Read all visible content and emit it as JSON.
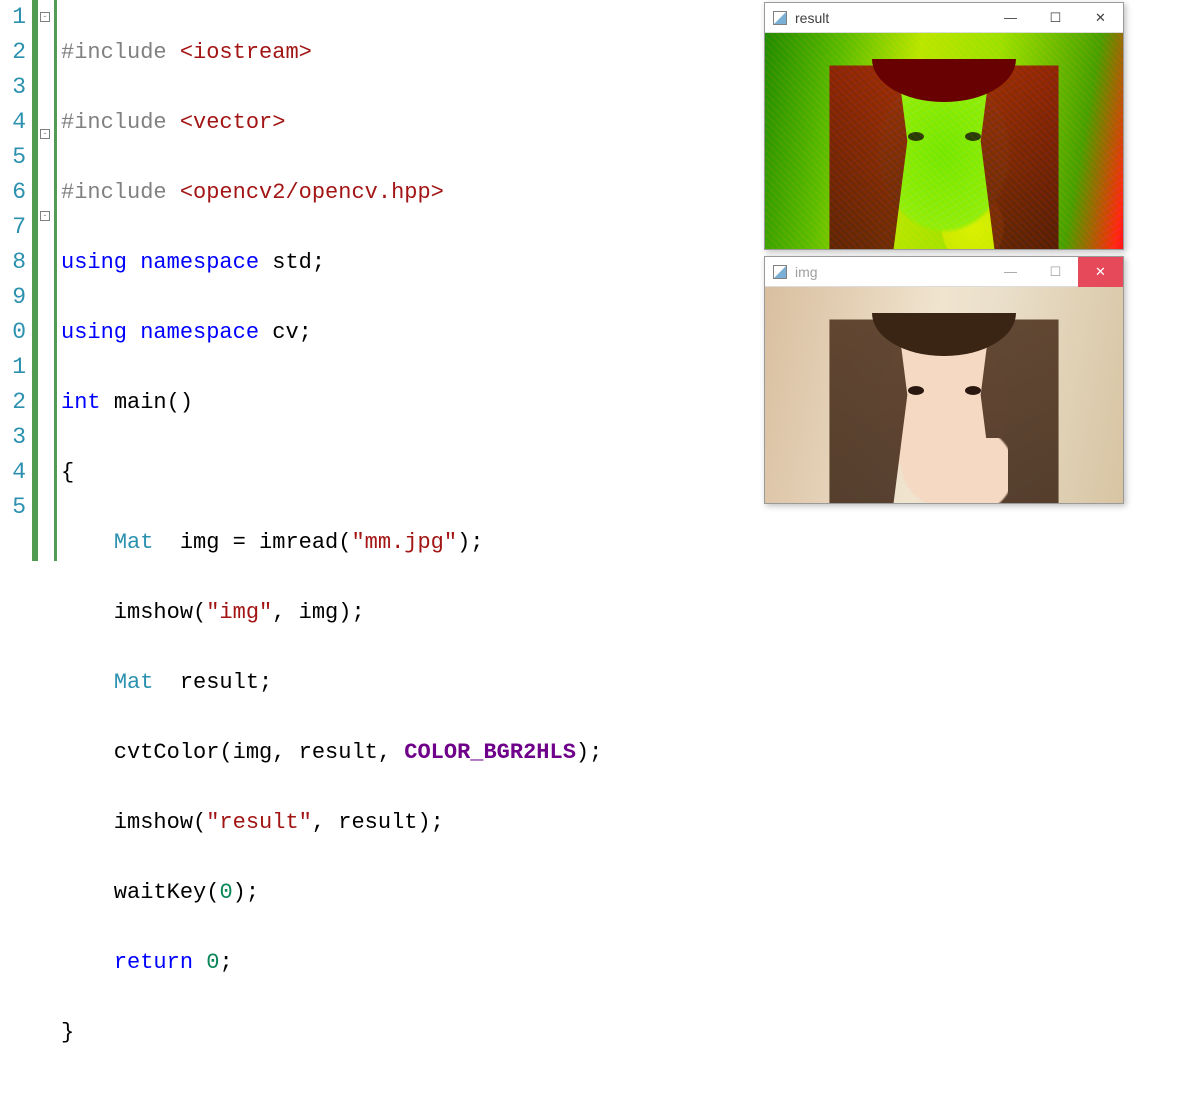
{
  "gutter": [
    "1",
    "2",
    "3",
    "4",
    "5",
    "6",
    "7",
    "8",
    "9",
    "0",
    "1",
    "2",
    "3",
    "4",
    "5"
  ],
  "code": {
    "l1": {
      "a": "#include ",
      "b": "<iostream>"
    },
    "l2": {
      "a": "#include ",
      "b": "<vector>"
    },
    "l3": {
      "a": "#include ",
      "b": "<opencv2/opencv.hpp>"
    },
    "l4": {
      "a": "using ",
      "b": "namespace ",
      "c": "std;"
    },
    "l5": {
      "a": "using ",
      "b": "namespace ",
      "c": "cv;"
    },
    "l6": {
      "a": "int ",
      "b": "main()"
    },
    "l7": {
      "a": "{"
    },
    "l8": {
      "a": "    ",
      "b": "Mat  ",
      "c": "img = imread(",
      "d": "\"mm.jpg\"",
      "e": ");"
    },
    "l9": {
      "a": "    imshow(",
      "b": "\"img\"",
      "c": ", img);"
    },
    "l10": {
      "a": "    ",
      "b": "Mat  ",
      "c": "result;"
    },
    "l11": {
      "a": "    cvtColor(img, result, ",
      "b": "COLOR_BGR2HLS",
      "c": ");"
    },
    "l12": {
      "a": "    imshow(",
      "b": "\"result\"",
      "c": ", result);"
    },
    "l13": {
      "a": "    waitKey(",
      "b": "0",
      "c": ");"
    },
    "l14": {
      "a": "    ",
      "b": "return ",
      "c": "0",
      "d": ";"
    },
    "l15": {
      "a": "}"
    }
  },
  "windows": {
    "result": {
      "title": "result",
      "minimize": "—",
      "maximize": "☐",
      "close": "✕"
    },
    "img": {
      "title": "img",
      "minimize": "—",
      "maximize": "☐",
      "close": "✕"
    }
  }
}
